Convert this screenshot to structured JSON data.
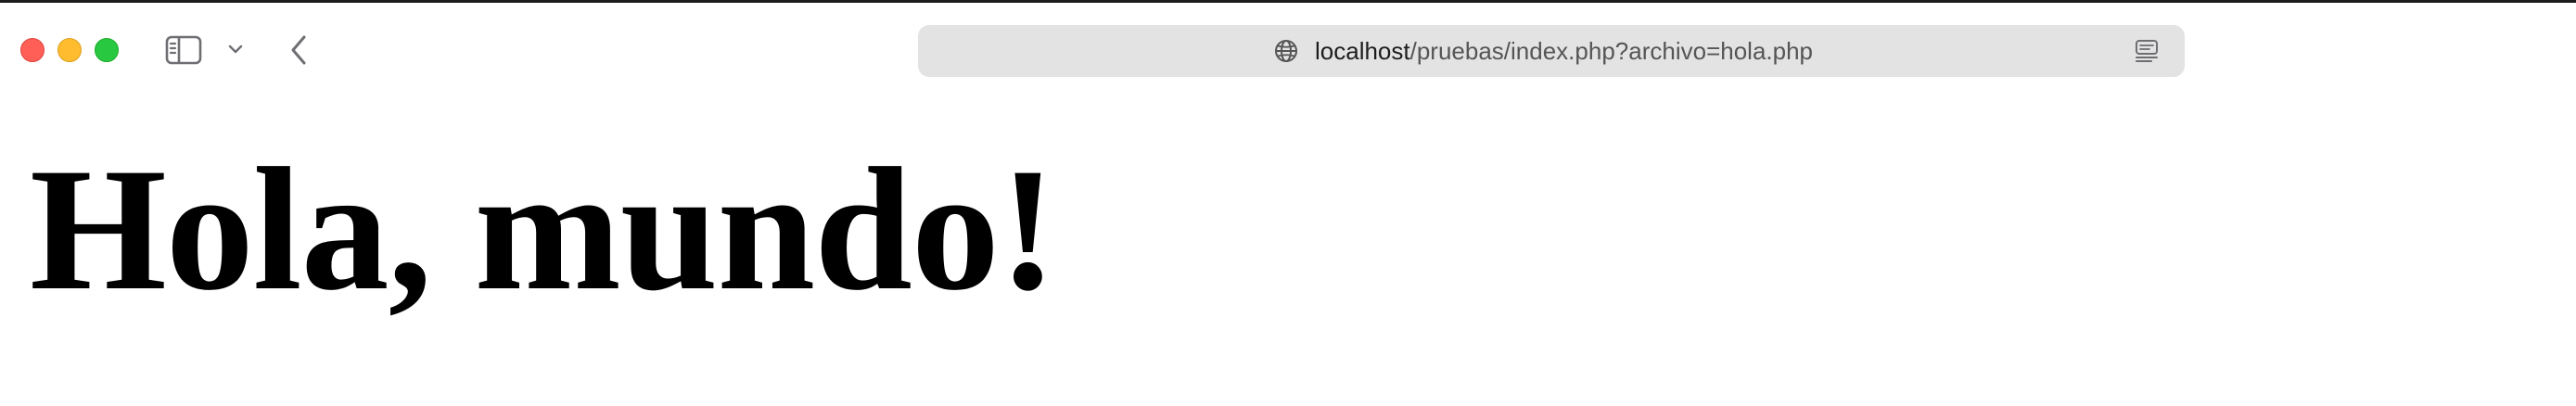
{
  "browser": {
    "url": {
      "host": "localhost",
      "path": "/pruebas/index.php?archivo=hola.php"
    },
    "icons": {
      "globe": "globe-icon",
      "reader": "reader-icon",
      "sidebar": "sidebar-icon",
      "back": "chevron-left-icon"
    },
    "traffic_lights": {
      "close": "#ff5f57",
      "minimize": "#febc2e",
      "zoom": "#28c840"
    }
  },
  "page": {
    "heading": "Hola, mundo!"
  }
}
